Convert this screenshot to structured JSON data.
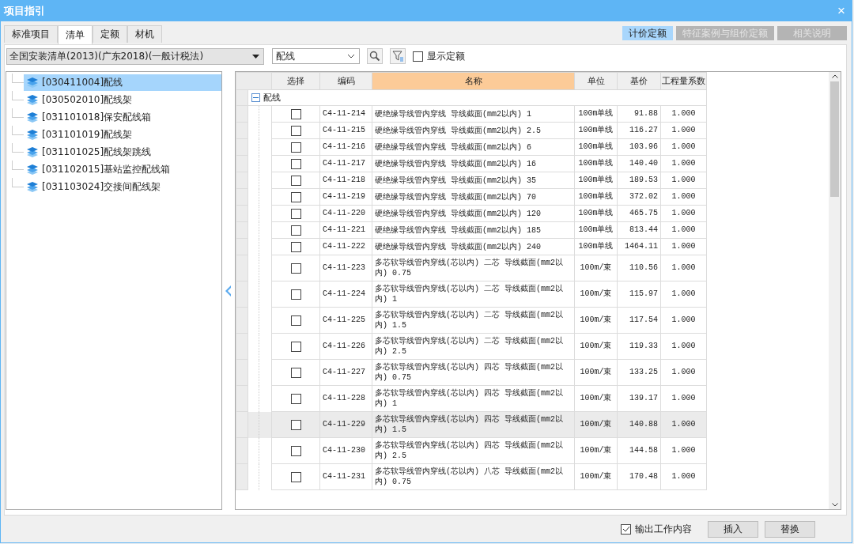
{
  "window": {
    "title": "项目指引",
    "close": "×"
  },
  "tabs": [
    {
      "label": "标准项目",
      "selected": false
    },
    {
      "label": "清单",
      "selected": true
    },
    {
      "label": "定额",
      "selected": false
    },
    {
      "label": "材机",
      "selected": false
    }
  ],
  "right_buttons": [
    {
      "label": "计价定额",
      "selected": true
    },
    {
      "label": "特征案例与组价定额",
      "selected": false
    },
    {
      "label": "相关说明",
      "selected": false
    }
  ],
  "toolbar": {
    "library": "全国安装清单(2013)(广东2018)(一般计税法)",
    "search_value": "配线",
    "show_quota": {
      "label": "显示定额",
      "checked": false
    }
  },
  "tree": [
    {
      "label": "[030411004]配线",
      "selected": true
    },
    {
      "label": "[030502010]配线架",
      "selected": false
    },
    {
      "label": "[031101018]保安配线箱",
      "selected": false
    },
    {
      "label": "[031101019]配线架",
      "selected": false
    },
    {
      "label": "[031101025]配线架跳线",
      "selected": false
    },
    {
      "label": "[031102015]基站监控配线箱",
      "selected": false
    },
    {
      "label": "[031103024]交接间配线架",
      "selected": false
    }
  ],
  "table": {
    "columns": [
      "选择",
      "编码",
      "名称",
      "单位",
      "基价",
      "工程量系数"
    ],
    "group": {
      "label": "配线",
      "expanded": true
    },
    "rows": [
      {
        "checked": false,
        "selected": false,
        "code": "C4-11-214",
        "name": "硬绝缘导线管内穿线 导线截面(mm2以内) 1",
        "unit": "100m单线",
        "price": "91.88",
        "coef": "1.000"
      },
      {
        "checked": false,
        "selected": false,
        "code": "C4-11-215",
        "name": "硬绝缘导线管内穿线 导线截面(mm2以内) 2.5",
        "unit": "100m单线",
        "price": "116.27",
        "coef": "1.000"
      },
      {
        "checked": false,
        "selected": false,
        "code": "C4-11-216",
        "name": "硬绝缘导线管内穿线 导线截面(mm2以内) 6",
        "unit": "100m单线",
        "price": "103.96",
        "coef": "1.000"
      },
      {
        "checked": false,
        "selected": false,
        "code": "C4-11-217",
        "name": "硬绝缘导线管内穿线 导线截面(mm2以内) 16",
        "unit": "100m单线",
        "price": "140.40",
        "coef": "1.000"
      },
      {
        "checked": false,
        "selected": false,
        "code": "C4-11-218",
        "name": "硬绝缘导线管内穿线 导线截面(mm2以内) 35",
        "unit": "100m单线",
        "price": "189.53",
        "coef": "1.000"
      },
      {
        "checked": false,
        "selected": false,
        "code": "C4-11-219",
        "name": "硬绝缘导线管内穿线 导线截面(mm2以内) 70",
        "unit": "100m单线",
        "price": "372.02",
        "coef": "1.000"
      },
      {
        "checked": false,
        "selected": false,
        "code": "C4-11-220",
        "name": "硬绝缘导线管内穿线 导线截面(mm2以内) 120",
        "unit": "100m单线",
        "price": "465.75",
        "coef": "1.000"
      },
      {
        "checked": false,
        "selected": false,
        "code": "C4-11-221",
        "name": "硬绝缘导线管内穿线 导线截面(mm2以内) 185",
        "unit": "100m单线",
        "price": "813.44",
        "coef": "1.000"
      },
      {
        "checked": false,
        "selected": false,
        "code": "C4-11-222",
        "name": "硬绝缘导线管内穿线 导线截面(mm2以内) 240",
        "unit": "100m单线",
        "price": "1464.11",
        "coef": "1.000"
      },
      {
        "checked": false,
        "selected": false,
        "code": "C4-11-223",
        "name": "多芯软导线管内穿线(芯以内) 二芯 导线截面(mm2以内) 0.75",
        "unit": "100m/束",
        "price": "110.56",
        "coef": "1.000"
      },
      {
        "checked": false,
        "selected": false,
        "code": "C4-11-224",
        "name": "多芯软导线管内穿线(芯以内) 二芯 导线截面(mm2以内) 1",
        "unit": "100m/束",
        "price": "115.97",
        "coef": "1.000"
      },
      {
        "checked": false,
        "selected": false,
        "code": "C4-11-225",
        "name": "多芯软导线管内穿线(芯以内) 二芯 导线截面(mm2以内) 1.5",
        "unit": "100m/束",
        "price": "117.54",
        "coef": "1.000"
      },
      {
        "checked": false,
        "selected": false,
        "code": "C4-11-226",
        "name": "多芯软导线管内穿线(芯以内) 二芯 导线截面(mm2以内) 2.5",
        "unit": "100m/束",
        "price": "119.33",
        "coef": "1.000"
      },
      {
        "checked": false,
        "selected": false,
        "code": "C4-11-227",
        "name": "多芯软导线管内穿线(芯以内) 四芯 导线截面(mm2以内) 0.75",
        "unit": "100m/束",
        "price": "133.25",
        "coef": "1.000"
      },
      {
        "checked": false,
        "selected": false,
        "code": "C4-11-228",
        "name": "多芯软导线管内穿线(芯以内) 四芯 导线截面(mm2以内) 1",
        "unit": "100m/束",
        "price": "139.17",
        "coef": "1.000"
      },
      {
        "checked": false,
        "selected": true,
        "code": "C4-11-229",
        "name": "多芯软导线管内穿线(芯以内) 四芯 导线截面(mm2以内) 1.5",
        "unit": "100m/束",
        "price": "140.88",
        "coef": "1.000"
      },
      {
        "checked": false,
        "selected": false,
        "code": "C4-11-230",
        "name": "多芯软导线管内穿线(芯以内) 四芯 导线截面(mm2以内) 2.5",
        "unit": "100m/束",
        "price": "144.58",
        "coef": "1.000"
      },
      {
        "checked": false,
        "selected": false,
        "code": "C4-11-231",
        "name": "多芯软导线管内穿线(芯以内) 八芯 导线截面(mm2以内) 0.75",
        "unit": "100m/束",
        "price": "170.48",
        "coef": "1.000"
      }
    ]
  },
  "footer": {
    "output_content": {
      "label": "输出工作内容",
      "checked": true
    },
    "buttons": [
      "插入",
      "替换"
    ]
  }
}
